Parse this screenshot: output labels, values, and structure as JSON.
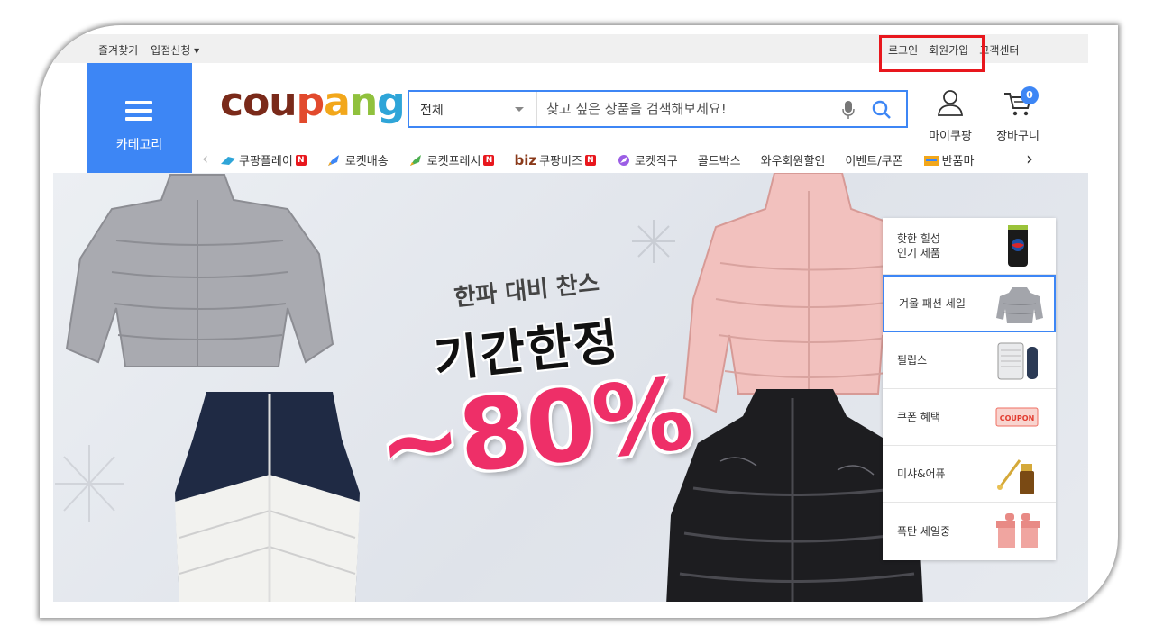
{
  "topbar": {
    "bookmark": "즐겨찾기",
    "seller_apply": "입점신청 ▾",
    "login": "로그인",
    "signup": "회원가입",
    "customer_center": "고객센터"
  },
  "header": {
    "category_label": "카테고리",
    "logo": {
      "c1": "cou",
      "c2": "p",
      "c3": "a",
      "c4": "n",
      "c5": "g"
    },
    "search": {
      "category_value": "전체",
      "placeholder": "찾고 싶은 상품을 검색해보세요!"
    },
    "my_coupang": "마이쿠팡",
    "cart_label": "장바구니",
    "cart_count": "0"
  },
  "nav": {
    "items": [
      {
        "label": "쿠팡플레이",
        "badge": "N"
      },
      {
        "label": "로켓배송"
      },
      {
        "label": "로켓프레시",
        "badge": "N"
      },
      {
        "prefix": "biz",
        "label": "쿠팡비즈",
        "badge": "N"
      },
      {
        "label": "로켓직구"
      },
      {
        "label": "골드박스"
      },
      {
        "label": "와우회원할인"
      },
      {
        "label": "이벤트/쿠폰"
      },
      {
        "label": "반품마"
      }
    ]
  },
  "banner": {
    "subtitle": "한파 대비 찬스",
    "title": "기간한정",
    "discount": "~80%"
  },
  "side_panel": [
    {
      "text": "핫한 힐성\n인기 제품"
    },
    {
      "text": "겨울 패션 세일"
    },
    {
      "text": "필립스"
    },
    {
      "text": "쿠폰 혜택",
      "coupon_text": "COUPON"
    },
    {
      "text": "미샤&어퓨"
    },
    {
      "text": "폭탄 세일중"
    }
  ],
  "colors": {
    "accent": "#3d86f5",
    "highlight_box": "#e8171d",
    "discount": "#ee2f68"
  }
}
